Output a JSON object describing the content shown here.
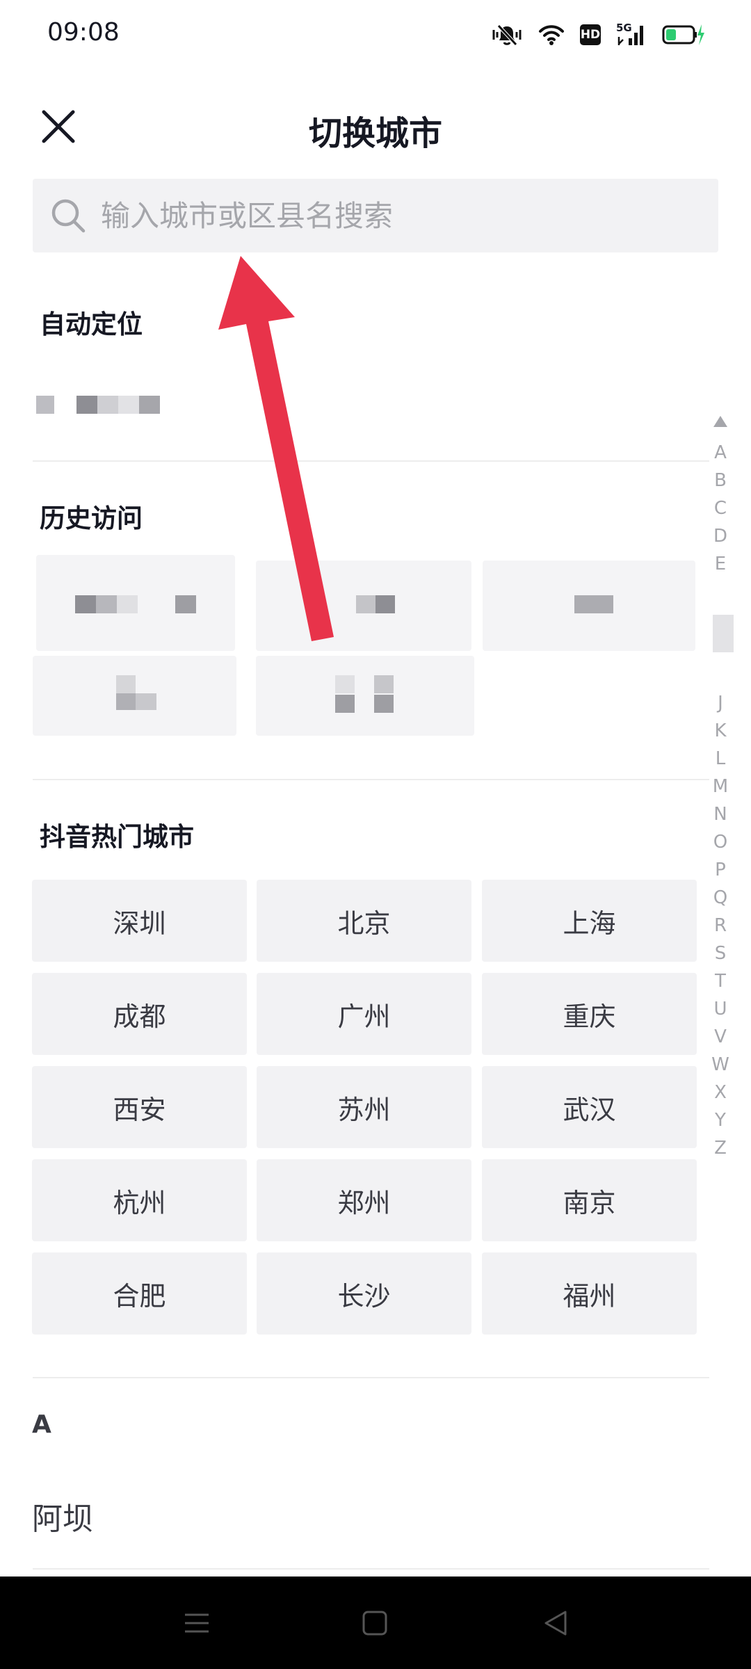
{
  "status": {
    "time": "09:08",
    "hd_label": "HD",
    "net_label": "5G",
    "icons": [
      "mute-vibrate-icon",
      "wifi-icon",
      "hd-icon",
      "signal-5g-icon",
      "battery-charging-icon"
    ]
  },
  "header": {
    "title": "切换城市",
    "close_icon": "close-icon"
  },
  "search": {
    "placeholder": "输入城市或区县名搜索",
    "value": ""
  },
  "auto_location": {
    "title": "自动定位"
  },
  "history": {
    "title": "历史访问"
  },
  "hot_cities": {
    "title": "抖音热门城市",
    "cities": [
      "深圳",
      "北京",
      "上海",
      "成都",
      "广州",
      "重庆",
      "西安",
      "苏州",
      "武汉",
      "杭州",
      "郑州",
      "南京",
      "合肥",
      "长沙",
      "福州"
    ]
  },
  "alphabet_index": [
    "A",
    "B",
    "C",
    "D",
    "E",
    "J",
    "K",
    "L",
    "M",
    "N",
    "O",
    "P",
    "Q",
    "R",
    "S",
    "T",
    "U",
    "V",
    "W",
    "X",
    "Y",
    "Z"
  ],
  "city_list": {
    "sections": [
      {
        "letter": "A",
        "cities": [
          "阿坝"
        ]
      }
    ]
  },
  "colors": {
    "accent_arrow": "#e8334a",
    "cell_bg": "#f2f2f4",
    "text_primary": "#161823",
    "text_muted": "#a5a6ab"
  },
  "nav": {
    "icons": [
      "menu-icon",
      "home-icon",
      "back-icon"
    ]
  }
}
